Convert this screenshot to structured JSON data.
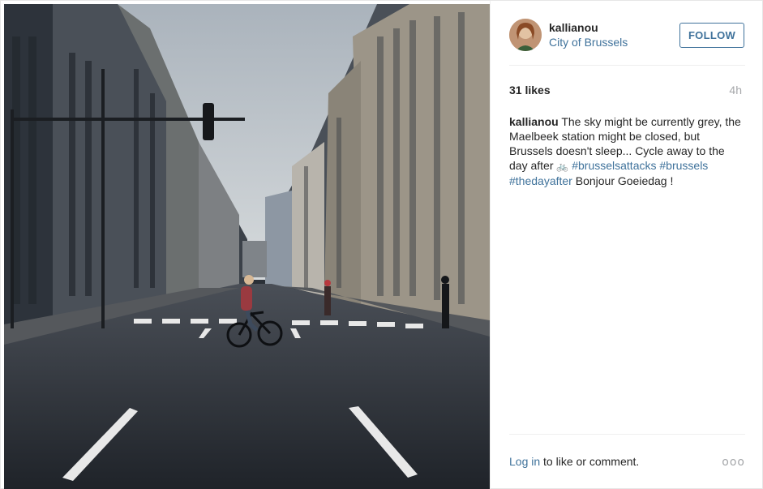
{
  "post": {
    "username": "kallianou",
    "location": "City of Brussels",
    "follow_label": "FOLLOW",
    "likes": "31 likes",
    "time_ago": "4h",
    "caption": {
      "author": "kallianou",
      "text_before": "The sky might be currently grey, the Maelbeek station might be closed, but Brussels doesn't sleep... Cycle away to the day after",
      "emoji": "🚲",
      "hashtag_1": "#brusselsattacks",
      "hashtag_2": "#brussels",
      "hashtag_3": "#thedayafter",
      "text_after": "Bonjour Goeiedag !"
    },
    "footer": {
      "login_link": "Log in",
      "login_rest": "to like or comment.",
      "more_icon": "ooo"
    }
  },
  "colors": {
    "link": "#3f729b",
    "muted": "#a5a7aa",
    "text": "#262626"
  },
  "icons": {
    "more": "more-options-icon",
    "bike": "bicycle-emoji"
  }
}
